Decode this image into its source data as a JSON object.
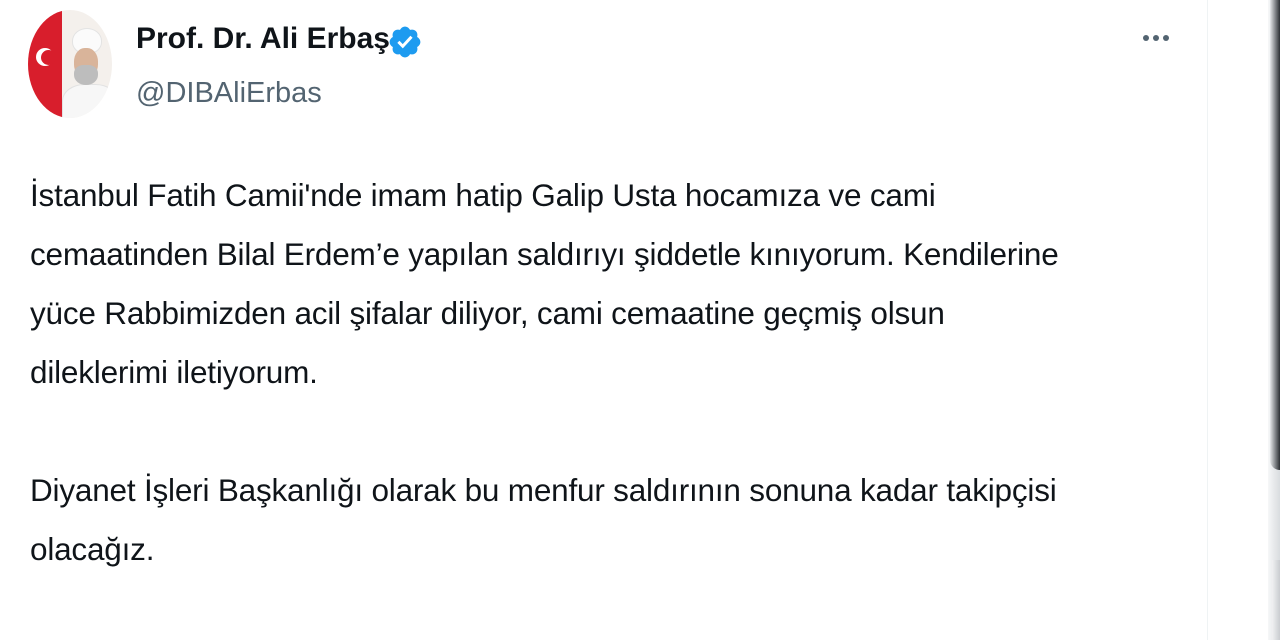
{
  "author": {
    "display_name": "Prof. Dr. Ali Erbaş",
    "handle": "@DIBAliErbas",
    "verified": true,
    "verified_color": "#1d9bf0"
  },
  "icons": {
    "verified": "verified-badge-icon",
    "more": "more-options-icon"
  },
  "tweet": {
    "paragraph_1": "İstanbul Fatih Camii'nde imam hatip Galip Usta hocamıza ve cami\ncemaatinden Bilal Erdem’e yapılan saldırıyı şiddetle kınıyorum. Kendilerine\nyüce Rabbimizden acil şifalar diliyor, cami cemaatine geçmiş olsun\ndileklerimi iletiyorum.",
    "paragraph_2": "Diyanet İşleri Başkanlığı olarak bu menfur saldırının sonuna kadar takipçisi\nolacağız."
  },
  "colors": {
    "text_primary": "#0f1419",
    "text_secondary": "#536471"
  }
}
